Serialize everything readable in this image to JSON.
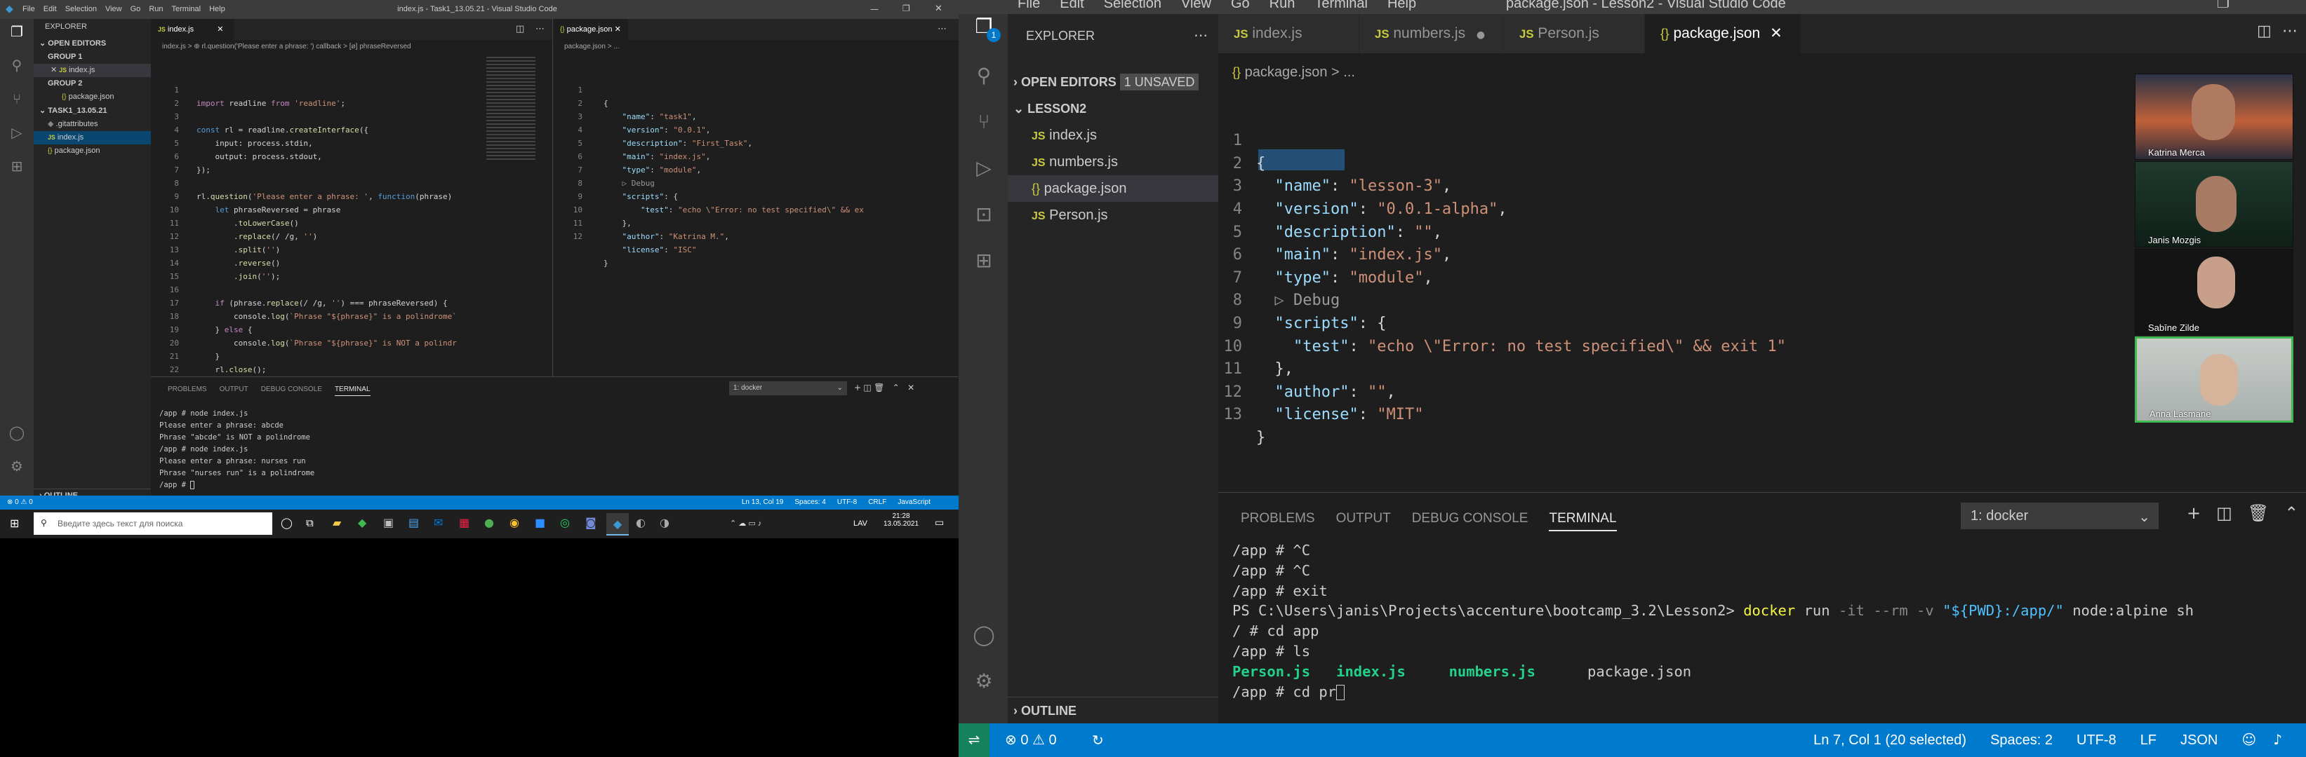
{
  "left": {
    "menu": [
      "File",
      "Edit",
      "Selection",
      "View",
      "Go",
      "Run",
      "Terminal",
      "Help"
    ],
    "window_title": "index.js - Task1_13.05.21 - Visual Studio Code",
    "explorer_label": "EXPLORER",
    "open_editors": "OPEN EDITORS",
    "group1": "GROUP 1",
    "group1_file": "index.js",
    "group2": "GROUP 2",
    "group2_file": "package.json",
    "folder": "TASK1_13.05.21",
    "files": [
      ".gitattributes",
      "index.js",
      "package.json"
    ],
    "outline": "OUTLINE",
    "tab1": "index.js",
    "tab2": "package.json",
    "breadcrumb1": "index.js > ⊕ rl.question('Please enter a phrase: ') callback > [ø] phraseReversed",
    "breadcrumb2": "package.json > ...",
    "code_js": [
      "import readline from 'readline';",
      "",
      "const rl = readline.createInterface({",
      "    input: process.stdin,",
      "    output: process.stdout,",
      "});",
      "",
      "rl.question('Please enter a phrase: ', function(phrase)",
      "    let phraseReversed = phrase",
      "        .toLowerCase()",
      "        .replace(/ /g, '')",
      "        .split('')",
      "        .reverse()",
      "        .join('');",
      "",
      "    if (phrase.replace(/ /g, '') === phraseReversed) {",
      "        console.log(`Phrase \"${phrase}\" is a polindrome`",
      "    } else {",
      "        console.log(`Phrase \"${phrase}\" is NOT a polindr",
      "    }",
      "    rl.close();",
      "});"
    ],
    "code_json": [
      "{",
      "    \"name\": \"task1\",",
      "    \"version\": \"0.0.1\",",
      "    \"description\": \"First_Task\",",
      "    \"main\": \"index.js\",",
      "    \"type\": \"module\",",
      "    ▷ Debug",
      "    \"scripts\": {",
      "        \"test\": \"echo \\\"Error: no test specified\\\" && ex",
      "    },",
      "    \"author\": \"Katrina M.\",",
      "    \"license\": \"ISC\"",
      "}"
    ],
    "json_line_numbers": [
      "1",
      "2",
      "3",
      "4",
      "5",
      "6",
      "",
      "7",
      "8",
      "9",
      "10",
      "11",
      "12"
    ],
    "panel_tabs": [
      "PROBLEMS",
      "OUTPUT",
      "DEBUG CONSOLE",
      "TERMINAL"
    ],
    "terminal_select": "1: docker",
    "terminal_lines": [
      "/app # node index.js",
      "Please enter a phrase: abcde",
      "Phrase \"abcde\" is NOT a polindrome",
      "/app # node index.js",
      "Please enter a phrase: nurses run",
      "Phrase \"nurses run\" is a polindrome",
      "/app # "
    ],
    "status_left": "⊗ 0 ⚠ 0",
    "status_items": [
      "Ln 13, Col 19",
      "Spaces: 4",
      "UTF-8",
      "CRLF",
      "JavaScript"
    ],
    "search_placeholder": "Введите здесь текст для поиска",
    "lang": "LAV",
    "time": "21:28",
    "date": "13.05.2021"
  },
  "right": {
    "menu": [
      "File",
      "Edit",
      "Selection",
      "View",
      "Go",
      "Run",
      "Terminal",
      "Help"
    ],
    "window_title": "package.json - Lesson2 - Visual Studio Code",
    "explorer_label": "EXPLORER",
    "open_editors": "OPEN EDITORS",
    "unsaved_badge": "1 UNSAVED",
    "folder": "LESSON2",
    "files": [
      "index.js",
      "numbers.js",
      "package.json",
      "Person.js"
    ],
    "outline": "OUTLINE",
    "tabs": [
      "index.js",
      "numbers.js",
      "Person.js",
      "package.json"
    ],
    "breadcrumb": "package.json > ...",
    "code_lines": [
      "{",
      "  \"name\": \"lesson-3\",",
      "  \"version\": \"0.0.1-alpha\",",
      "  \"description\": \"\",",
      "  \"main\": \"index.js\",",
      "  \"type\": \"module\",",
      "  ▷ Debug",
      "  \"scripts\": {",
      "    \"test\": \"echo \\\"Error: no test specified\\\" && exit 1\"",
      "  },",
      "  \"author\": \"\",",
      "  \"license\": \"MIT\"",
      "}",
      ""
    ],
    "line_numbers": [
      "1",
      "2",
      "3",
      "4",
      "5",
      "6",
      "",
      "7",
      "8",
      "9",
      "10",
      "11",
      "12",
      "13"
    ],
    "panel_tabs": [
      "PROBLEMS",
      "OUTPUT",
      "DEBUG CONSOLE",
      "TERMINAL"
    ],
    "terminal_select": "1: docker",
    "terminal_lines": [
      "/app # ^C",
      "/app # ^C",
      "/app # exit",
      "PS C:\\Users\\janis\\Projects\\accenture\\bootcamp_3.2\\Lesson2> docker run -it --rm -v \"${PWD}:/app/\" node:alpine sh",
      "/ # cd app",
      "/app # ls"
    ],
    "ls_files": [
      "Person.js",
      "index.js",
      "numbers.js",
      "package.json"
    ],
    "last_line": "/app # cd pr",
    "status_errors": "⊗ 0 ⚠ 0",
    "status_items": [
      "Ln 7, Col 1 (20 selected)",
      "Spaces: 2",
      "UTF-8",
      "LF",
      "JSON"
    ],
    "participants": [
      "Katrina Merca",
      "Janis Mozgis",
      "Sabīne Zilde",
      "Anna Lasmane"
    ],
    "badge_count": "1"
  }
}
